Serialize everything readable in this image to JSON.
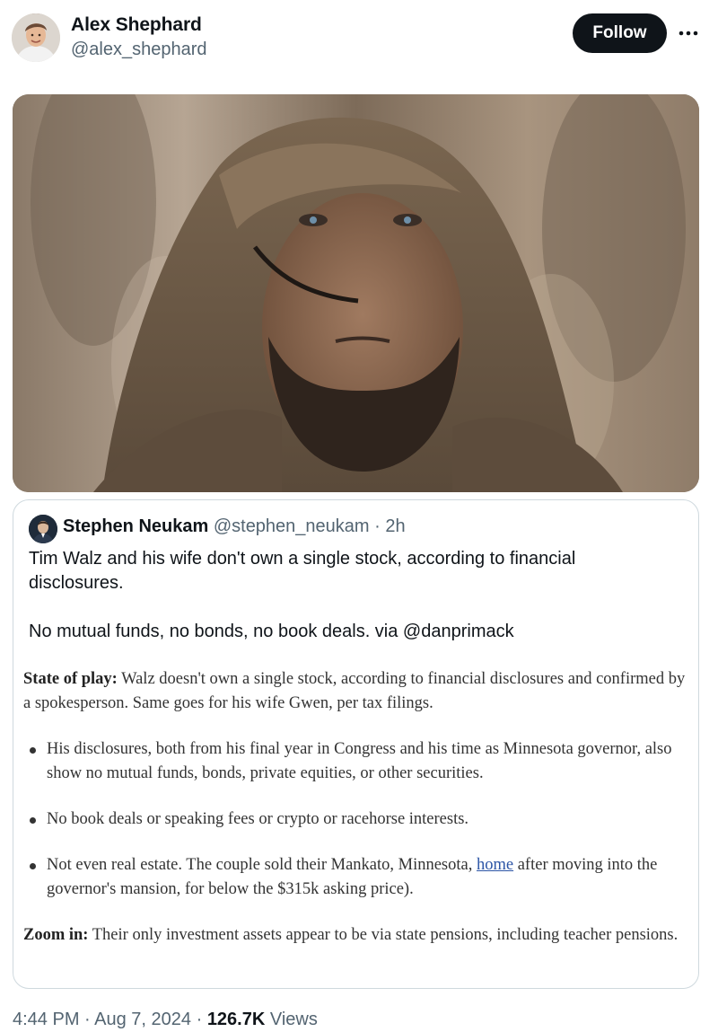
{
  "author": {
    "display_name": "Alex Shephard",
    "handle": "@alex_shephard",
    "avatar_icon": "user-avatar-photo"
  },
  "actions": {
    "follow_label": "Follow",
    "more_icon": "more-horizontal-icon"
  },
  "media": {
    "kind": "photo"
  },
  "quoted_tweet": {
    "display_name": "Stephen Neukam",
    "handle": "@stephen_neukam",
    "separator": " · ",
    "time_ago": "2h",
    "text_line_1": "Tim Walz and his wife don't own a single stock, according to financial disclosures.",
    "text_line_2": "No mutual funds, no bonds, no book deals. via @danprimack",
    "article": {
      "state_label": "State of play:",
      "state_text": " Walz doesn't own a single stock, according to financial disclosures and confirmed by a spokesperson. Same goes for his wife Gwen, per tax filings.",
      "bullets": [
        "His disclosures, both from his final year in Congress and his time as Minnesota governor, also show no mutual funds, bonds, private equities, or other securities.",
        "No book deals or speaking fees or crypto or racehorse interests."
      ],
      "bullet_3_before": "Not even real estate. The couple sold their Mankato, Minnesota, ",
      "bullet_3_link": "home",
      "bullet_3_after": " after moving into the governor's mansion, for below the $315k asking price).",
      "zoom_label": "Zoom in:",
      "zoom_text": " Their only investment assets appear to be via state pensions, including teacher pensions."
    }
  },
  "footer": {
    "time": "4:44 PM",
    "sep1": " · ",
    "date": "Aug 7, 2024",
    "sep2": " · ",
    "views_count": "126.7K",
    "views_label": " Views"
  },
  "colors": {
    "text_primary": "#0f1419",
    "text_secondary": "#536471",
    "border": "#cfd9de",
    "follow_bg": "#0f1419",
    "link": "#2c55a6"
  }
}
